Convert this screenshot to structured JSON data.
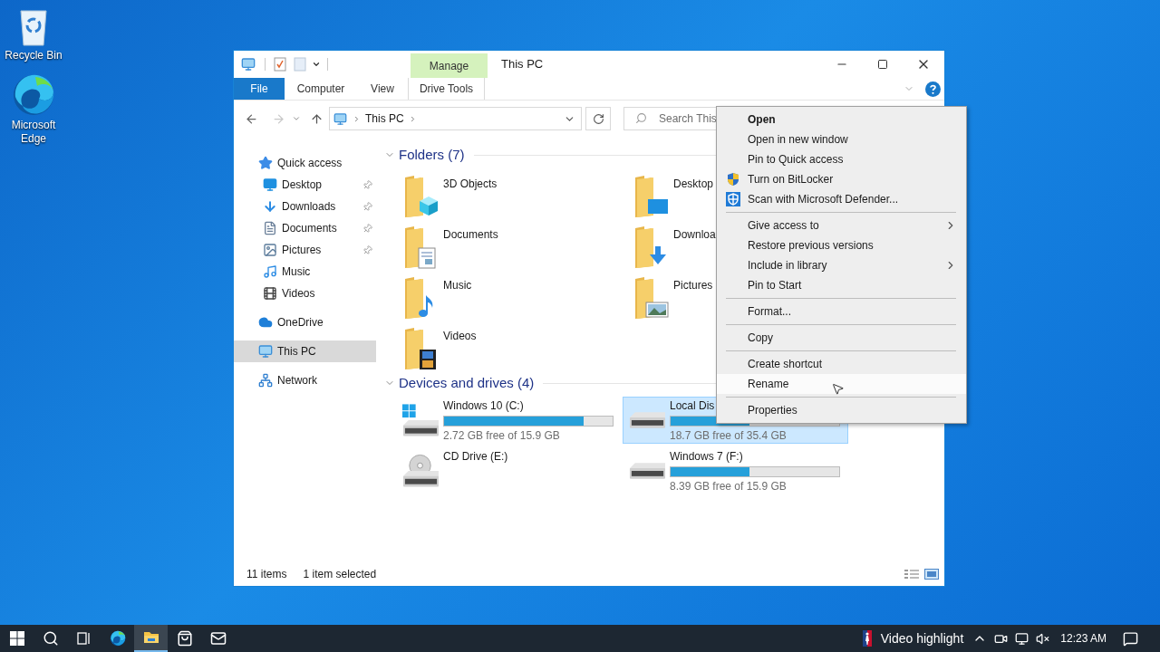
{
  "desktop_icons": [
    {
      "label": "Recycle Bin",
      "kind": "recycle"
    },
    {
      "label": "Microsoft Edge",
      "kind": "edge"
    }
  ],
  "window": {
    "title": "This PC",
    "contextual_group": "Manage",
    "ribbon_tabs": [
      {
        "label": "File",
        "kind": "file"
      },
      {
        "label": "Computer",
        "kind": "tab"
      },
      {
        "label": "View",
        "kind": "tab"
      },
      {
        "label": "Drive Tools",
        "kind": "contextual"
      }
    ],
    "breadcrumb": [
      "This PC"
    ],
    "search": {
      "placeholder": "Search This"
    },
    "nav": [
      {
        "label": "Quick access",
        "kind": "star",
        "selected": false,
        "children": [
          {
            "label": "Desktop",
            "kind": "desktop",
            "pinned": true,
            "selected": false
          },
          {
            "label": "Downloads",
            "kind": "downloads",
            "pinned": true,
            "selected": false
          },
          {
            "label": "Documents",
            "kind": "documents",
            "pinned": true,
            "selected": false
          },
          {
            "label": "Pictures",
            "kind": "pictures",
            "pinned": true,
            "selected": false
          },
          {
            "label": "Music",
            "kind": "music",
            "pinned": false,
            "selected": false
          },
          {
            "label": "Videos",
            "kind": "videos",
            "pinned": false,
            "selected": false
          }
        ]
      },
      {
        "label": "OneDrive",
        "kind": "cloud",
        "selected": false
      },
      {
        "label": "This PC",
        "kind": "pc",
        "selected": true
      },
      {
        "label": "Network",
        "kind": "network",
        "selected": false
      }
    ],
    "folders": {
      "heading": "Folders (7)",
      "expanded": true,
      "items": [
        {
          "label": "3D Objects",
          "kind": "objects"
        },
        {
          "label": "Desktop",
          "kind": "desktop"
        },
        {
          "label": "Documents",
          "kind": "documents"
        },
        {
          "label": "Downloa",
          "kind": "downloads"
        },
        {
          "label": "Music",
          "kind": "music"
        },
        {
          "label": "Pictures",
          "kind": "pictures"
        },
        {
          "label": "Videos",
          "kind": "videos"
        }
      ]
    },
    "drives": {
      "heading": "Devices and drives (4)",
      "expanded": true,
      "items": [
        {
          "label": "Windows 10 (C:)",
          "kind": "windows",
          "selected": false,
          "level": 0.83,
          "free": "2.72 GB free of 15.9 GB"
        },
        {
          "label": "Local Dis",
          "kind": "disk",
          "selected": true,
          "level": 0.47,
          "free": "18.7 GB free of 35.4 GB"
        },
        {
          "label": "CD Drive (E:)",
          "kind": "cd",
          "selected": false
        },
        {
          "label": "Windows 7 (F:)",
          "kind": "disk",
          "selected": false,
          "level": 0.47,
          "free": "8.39 GB free of 15.9 GB"
        }
      ]
    },
    "status_bar": {
      "count": "11 items",
      "selection": "1 item selected"
    }
  },
  "context_menu": {
    "items": [
      {
        "label": "Open",
        "kind": "default",
        "selected": false
      },
      {
        "label": "Open in new window",
        "kind": "plain",
        "selected": false
      },
      {
        "label": "Pin to Quick access",
        "kind": "plain",
        "selected": false
      },
      {
        "label": "Turn on BitLocker",
        "kind": "shield",
        "selected": false
      },
      {
        "label": "Scan with Microsoft Defender...",
        "kind": "defender",
        "selected": false
      },
      {
        "kind": "separator"
      },
      {
        "label": "Give access to",
        "kind": "submenu",
        "selected": false
      },
      {
        "label": "Restore previous versions",
        "kind": "plain",
        "selected": false
      },
      {
        "label": "Include in library",
        "kind": "submenu",
        "selected": false
      },
      {
        "label": "Pin to Start",
        "kind": "plain",
        "selected": false
      },
      {
        "kind": "separator"
      },
      {
        "label": "Format...",
        "kind": "plain",
        "selected": false
      },
      {
        "kind": "separator"
      },
      {
        "label": "Copy",
        "kind": "plain",
        "selected": false
      },
      {
        "kind": "separator"
      },
      {
        "label": "Create shortcut",
        "kind": "plain",
        "selected": false
      },
      {
        "label": "Rename",
        "kind": "plain",
        "selected": true
      },
      {
        "kind": "separator"
      },
      {
        "label": "Properties",
        "kind": "plain",
        "selected": false
      }
    ]
  },
  "taskbar": {
    "apps": [
      {
        "kind": "start",
        "selected": false
      },
      {
        "kind": "search",
        "selected": false
      },
      {
        "kind": "taskview",
        "selected": false
      },
      {
        "kind": "edge",
        "selected": false
      },
      {
        "kind": "explorer",
        "selected": true
      },
      {
        "kind": "store",
        "selected": false
      },
      {
        "kind": "mail",
        "selected": false
      }
    ],
    "tray_label": "Video highlight",
    "time": "12:23 AM"
  }
}
